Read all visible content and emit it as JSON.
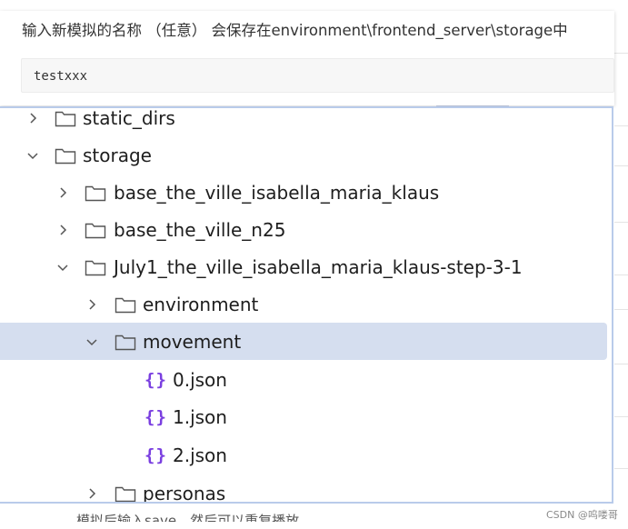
{
  "prompt": {
    "title": "输入新模拟的名称 （任意） 会保存在environment\\frontend_server\\storage中",
    "input_value": "testxxx"
  },
  "tree": {
    "items": [
      {
        "label": "static_dirs",
        "kind": "folder",
        "expanded": false
      },
      {
        "label": "storage",
        "kind": "folder",
        "expanded": true
      },
      {
        "label": "base_the_ville_isabella_maria_klaus",
        "kind": "folder",
        "expanded": false
      },
      {
        "label": "base_the_ville_n25",
        "kind": "folder",
        "expanded": false
      },
      {
        "label": "July1_the_ville_isabella_maria_klaus-step-3-1",
        "kind": "folder",
        "expanded": true
      },
      {
        "label": "environment",
        "kind": "folder",
        "expanded": false
      },
      {
        "label": "movement",
        "kind": "folder",
        "expanded": true,
        "selected": true
      },
      {
        "label": "0.json",
        "kind": "json-file"
      },
      {
        "label": "1.json",
        "kind": "json-file"
      },
      {
        "label": "2.json",
        "kind": "json-file"
      },
      {
        "label": "personas",
        "kind": "folder",
        "expanded": false
      }
    ],
    "json_icon_glyph": "{}"
  },
  "background": {
    "bottom_text": "模拟后输入save，然后可以重复播放"
  },
  "watermark": "CSDN @呜喽哥",
  "colors": {
    "selected_row": "#d5deef",
    "panel_border": "#b9cbea",
    "json_icon": "#7a3fe0"
  }
}
